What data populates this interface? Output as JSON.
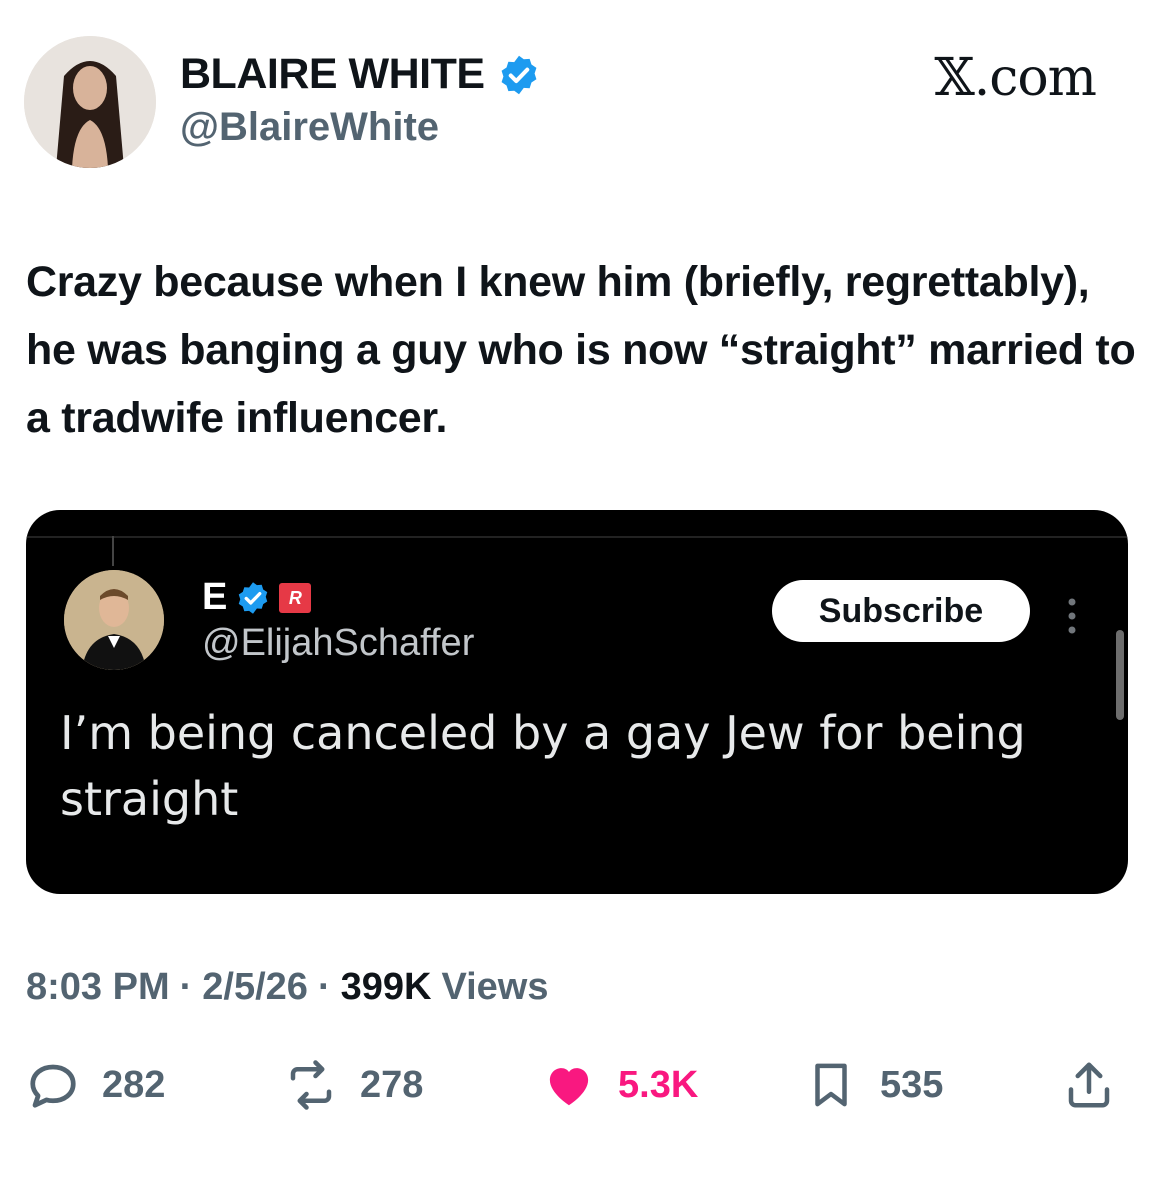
{
  "header": {
    "display_name": "BLAIRE WHITE",
    "handle": "@BlaireWhite",
    "brand": "𝕏.com",
    "verified_color": "#1d9bf0"
  },
  "tweet": {
    "text": "Crazy because when I knew him (briefly, regrettably), he was banging a guy who is now “straight” married to a tradwife influencer."
  },
  "quoted": {
    "display_name": "E",
    "badge_text": "R",
    "handle": "@ElijahSchaffer",
    "subscribe_label": "Subscribe",
    "text": "I’m being canceled by a gay Jew for being straight"
  },
  "meta": {
    "time": "8:03 PM",
    "sep1": "·",
    "date": "2/5/26",
    "sep2": "·",
    "views_count": "399K",
    "views_label": "Views"
  },
  "actions": {
    "replies": "282",
    "reposts": "278",
    "likes": "5.3K",
    "bookmarks": "535",
    "like_color": "#f91880",
    "icon_color": "#536471"
  }
}
